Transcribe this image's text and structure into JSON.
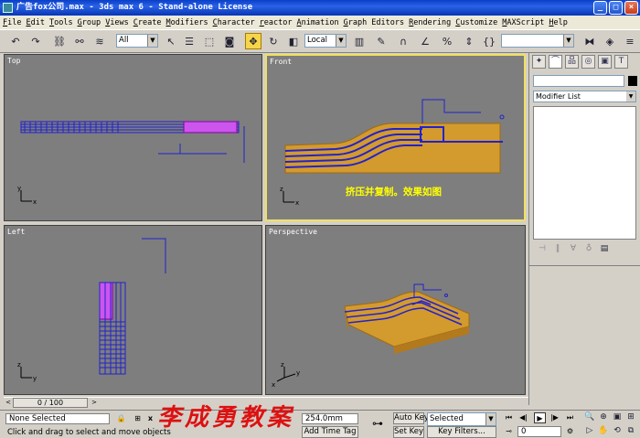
{
  "window": {
    "title": "广告fox公司.max - 3ds max 6 - Stand-alone License",
    "buttons": [
      "_",
      "□",
      "×"
    ]
  },
  "menu": [
    "File",
    "Edit",
    "Tools",
    "Group",
    "Views",
    "Create",
    "Modifiers",
    "Character",
    "reactor",
    "Animation",
    "Graph Editors",
    "Rendering",
    "Customize",
    "MAXScript",
    "Help"
  ],
  "toolbar": {
    "selection_filter": "All",
    "reference_coord": "Local",
    "named_selection": "",
    "icons": [
      "undo-icon",
      "redo-icon",
      "link-icon",
      "unlink-icon",
      "bind-space-warp-icon",
      "select-icon",
      "select-by-name-icon",
      "region-select-icon",
      "crossing-icon",
      "move-icon",
      "rotate-icon",
      "scale-icon",
      "pivot-icon",
      "manipulate-icon",
      "snap-icon",
      "angle-snap-icon",
      "percent-snap-icon",
      "spinner-snap-icon",
      "edit-named-selection-icon",
      "mirror-icon",
      "align-icon"
    ]
  },
  "viewports": {
    "top": {
      "label": "Top"
    },
    "front": {
      "label": "Front",
      "caption": "挤压并复制。效果如图"
    },
    "left": {
      "label": "Left"
    },
    "perspective": {
      "label": "Perspective"
    }
  },
  "axis": {
    "x": "x",
    "y": "y",
    "z": "z"
  },
  "command_panel": {
    "tabs": [
      "create-tab",
      "modify-tab",
      "hierarchy-tab",
      "motion-tab",
      "display-tab",
      "utilities-tab"
    ],
    "modifier_list": "Modifier List"
  },
  "timeline": {
    "frame_label": "0 / 100",
    "prev": "<",
    "next": ">"
  },
  "status": {
    "selection": "None Selected",
    "prompt": "Click and drag to select and move objects",
    "coord": "254.0mm",
    "add_time_tag": "Add Time Tag",
    "auto_key": "Auto Key",
    "set_key": "Set Key",
    "key_mode": "Selected",
    "key_filters": "Key Filters...",
    "current_frame": "0"
  },
  "watermark": "李成勇教案",
  "colors": {
    "viewport_bg": "#7e7e7e",
    "active_border": "#f0e060",
    "object_fill": "#d39a2e",
    "wire": "#2222cc",
    "selected_wire": "#cc55ee",
    "caption": "#ffff00",
    "watermark": "#dd1111"
  }
}
